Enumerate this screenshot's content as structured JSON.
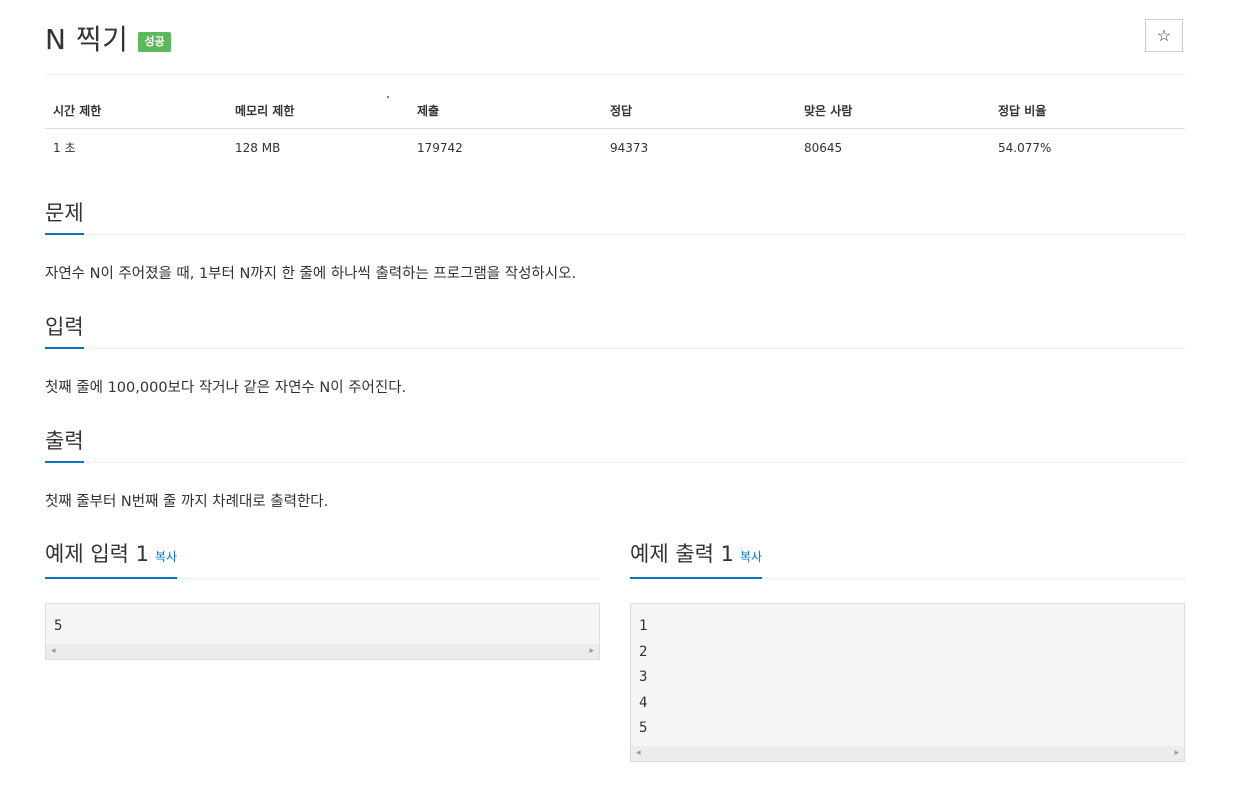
{
  "problem": {
    "title": "N 찍기",
    "status_badge": "성공",
    "star_icon": "☆"
  },
  "info_table": {
    "headers": [
      "시간 제한",
      "메모리 제한",
      "제출",
      "정답",
      "맞은 사람",
      "정답 비율"
    ],
    "values": [
      "1 초",
      "128 MB",
      "179742",
      "94373",
      "80645",
      "54.077%"
    ]
  },
  "sections": {
    "description": {
      "title": "문제",
      "text": "자연수 N이 주어졌을 때, 1부터 N까지 한 줄에 하나씩 출력하는 프로그램을 작성하시오."
    },
    "input": {
      "title": "입력",
      "text": "첫째 줄에 100,000보다 작거나 같은 자연수 N이 주어진다."
    },
    "output": {
      "title": "출력",
      "text": "첫째 줄부터 N번째 줄 까지 차례대로 출력한다."
    }
  },
  "samples": {
    "input": {
      "title": "예제 입력 1",
      "copy_label": "복사",
      "lines": [
        "5"
      ]
    },
    "output": {
      "title": "예제 출력 1",
      "copy_label": "복사",
      "lines": [
        "1",
        "2",
        "3",
        "4",
        "5"
      ]
    }
  },
  "scroll_arrows": {
    "left": "◂",
    "right": "▸"
  },
  "colors": {
    "accent": "#0076c0",
    "success": "#5cb85c",
    "pre_bg": "#f5f5f7"
  }
}
